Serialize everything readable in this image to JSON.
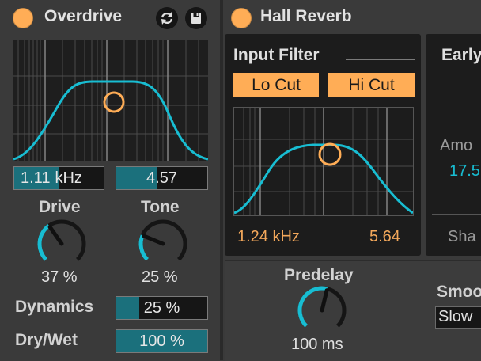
{
  "overdrive": {
    "title": "Overdrive",
    "freq_value": "1.11",
    "freq_unit": "kHz",
    "freq_level": 0.5,
    "width_value": "4.57",
    "width_level": 0.45,
    "drive_label": "Drive",
    "drive_value": "37 %",
    "drive_level": 0.37,
    "tone_label": "Tone",
    "tone_value": "25 %",
    "tone_level": 0.25,
    "dynamics_label": "Dynamics",
    "dynamics_value": "25 %",
    "dynamics_level": 0.25,
    "drywet_label": "Dry/Wet",
    "drywet_value": "100 %",
    "drywet_level": 1.0,
    "icons": [
      "hot-swap-icon",
      "save-preset-icon"
    ]
  },
  "reverb": {
    "title": "Hall Reverb",
    "input_filter_label": "Input Filter",
    "lo_cut_label": "Lo Cut",
    "hi_cut_label": "Hi Cut",
    "filter_freq": "1.24 kHz",
    "filter_width": "5.64",
    "early_label": "Early",
    "amount_label": "Amo",
    "amount_value": "17.5",
    "shape_label": "Sha",
    "predelay_label": "Predelay",
    "predelay_value": "100 ms",
    "predelay_level": 0.55,
    "smoothing_label": "Smoo",
    "smoothing_value": "Slow"
  },
  "colors": {
    "accent_orange": "#ffad56",
    "accent_cyan": "#18bdd2",
    "value_fill": "#1b707c",
    "panel_bg": "#3a3a3a",
    "display_bg": "#1e1e1e"
  }
}
